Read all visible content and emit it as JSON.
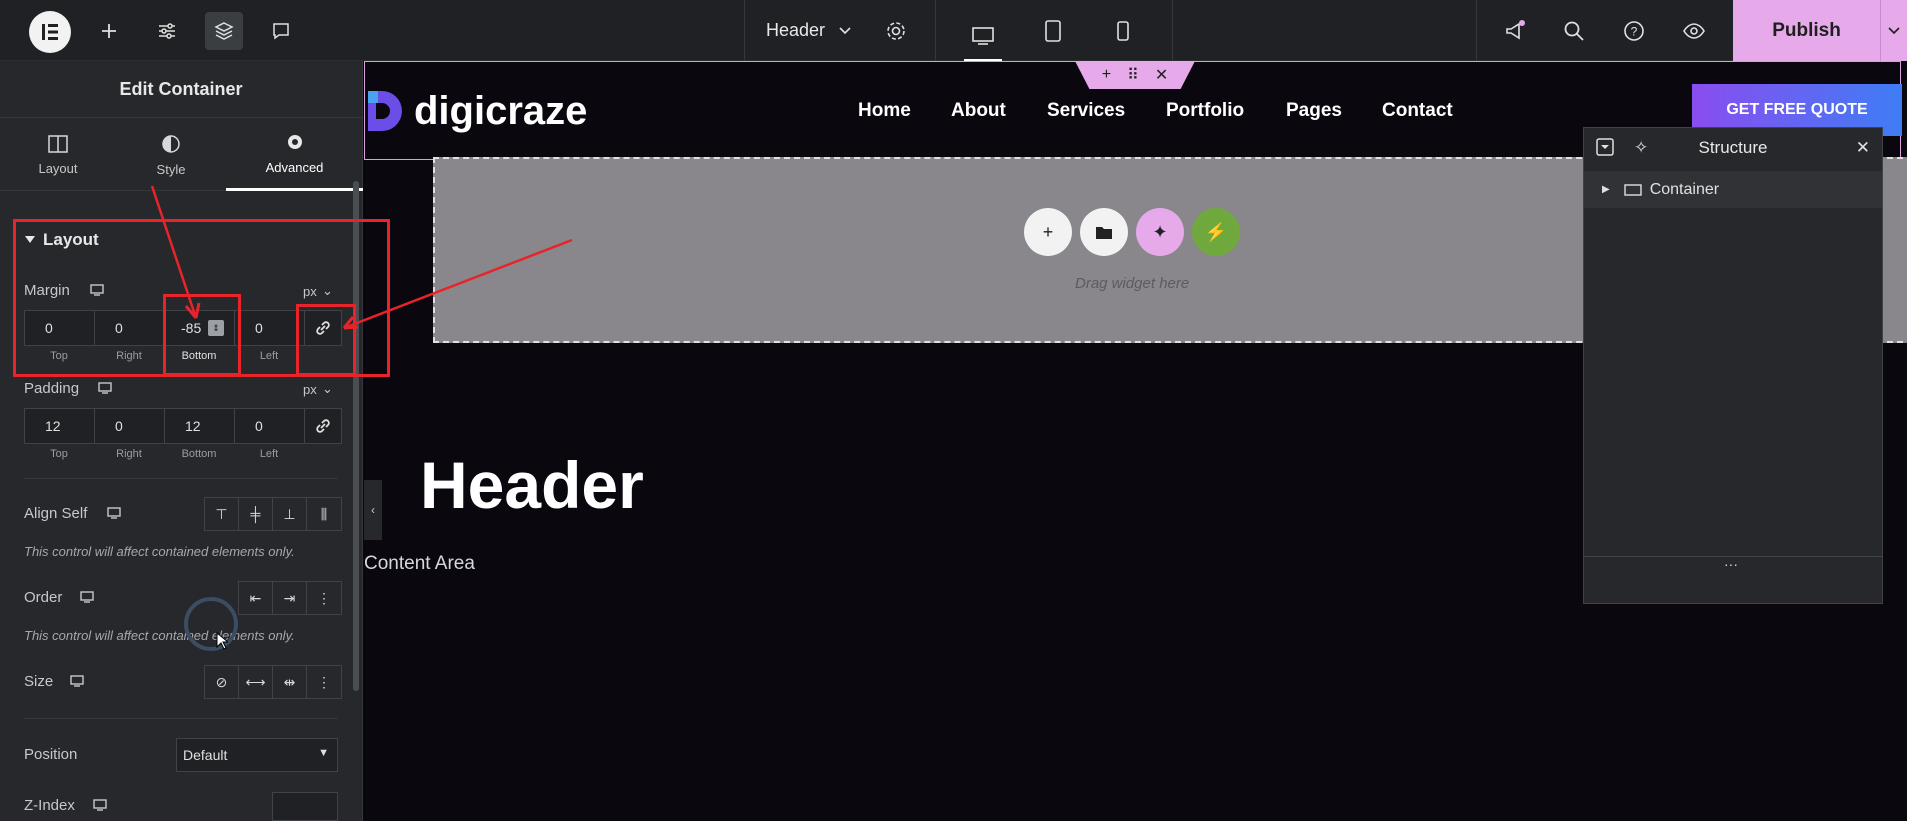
{
  "topbar": {
    "doc_name": "Header",
    "publish_label": "Publish"
  },
  "panel": {
    "title": "Edit Container",
    "tabs": [
      {
        "label": "Layout"
      },
      {
        "label": "Style"
      },
      {
        "label": "Advanced"
      }
    ],
    "section_title": "Layout",
    "margin": {
      "label": "Margin",
      "unit": "px",
      "values": [
        "0",
        "0",
        "-85",
        "0"
      ],
      "sublabels": [
        "Top",
        "Right",
        "Bottom",
        "Left"
      ]
    },
    "padding": {
      "label": "Padding",
      "unit": "px",
      "values": [
        "12",
        "0",
        "12",
        "0"
      ],
      "sublabels": [
        "Top",
        "Right",
        "Bottom",
        "Left"
      ]
    },
    "align_self_label": "Align Self",
    "align_note": "This control will affect contained elements only.",
    "order_label": "Order",
    "order_note": "This control will affect contained elements only.",
    "size_label": "Size",
    "position_label": "Position",
    "position_value": "Default",
    "zindex_label": "Z-Index"
  },
  "canvas": {
    "site_name": "digicraze",
    "nav": [
      "Home",
      "About",
      "Services",
      "Portfolio",
      "Pages",
      "Contact"
    ],
    "cta": "GET FREE QUOTE",
    "drag_text": "Drag widget here",
    "heading": "Header",
    "content_area": "Content Area"
  },
  "structure": {
    "title": "Structure",
    "item": "Container"
  },
  "colors": {
    "accent": "#e6a9e9",
    "annotation": "#e8232a",
    "canvas_bg": "#0a070e",
    "panel_bg": "#26282b"
  }
}
